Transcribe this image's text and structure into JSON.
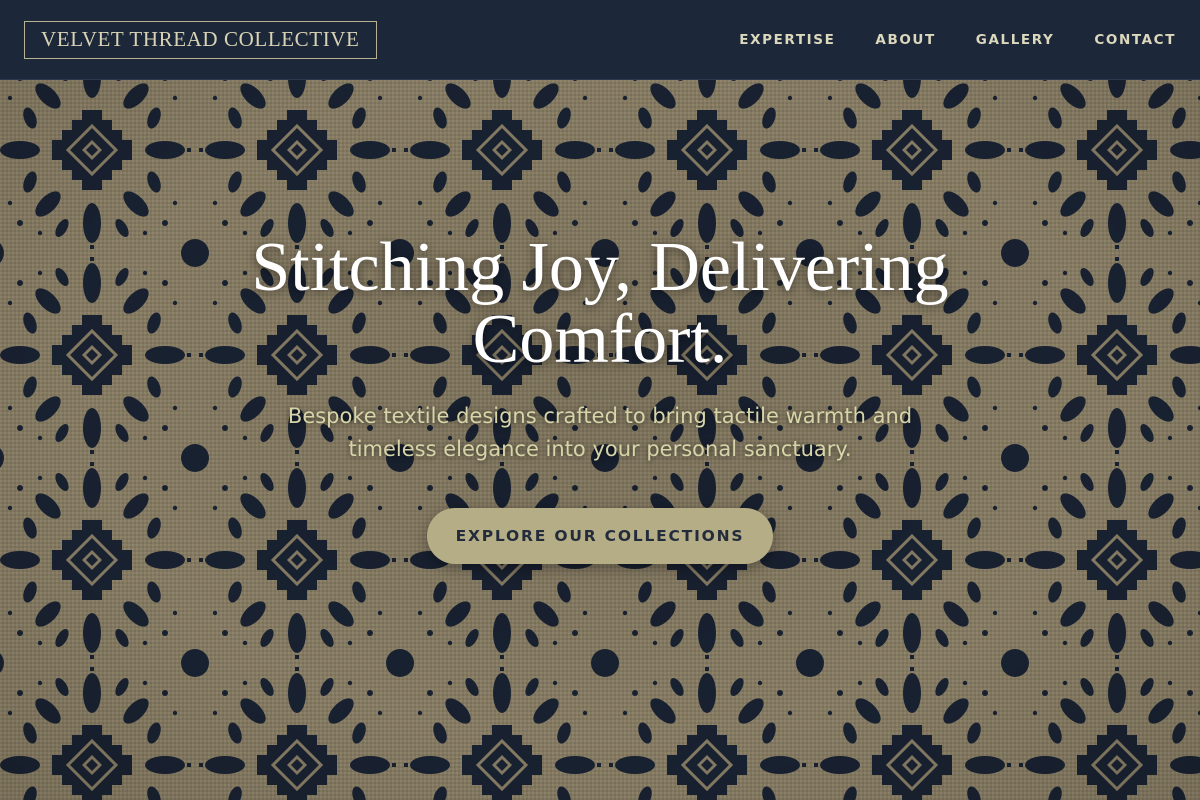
{
  "header": {
    "logo": "VELVET THREAD COLLECTIVE",
    "nav": [
      {
        "label": "EXPERTISE"
      },
      {
        "label": "ABOUT"
      },
      {
        "label": "GALLERY"
      },
      {
        "label": "CONTACT"
      }
    ]
  },
  "hero": {
    "title": "Stitching Joy, Delivering Comfort.",
    "subtitle": "Bespoke textile designs crafted to bring tactile warmth and timeless elegance into your personal sanctuary.",
    "cta_label": "EXPLORE OUR COLLECTIONS",
    "background_icon": "woven-damask-pattern"
  },
  "colors": {
    "header_bg": "#1c2739",
    "logo_text": "#d8d3b4",
    "nav_text": "#dcd8bd",
    "pattern_base": "#8c8168",
    "pattern_ink": "#1a2333",
    "subtitle_text": "#d6d4a8",
    "cta_bg": "#b4ad86",
    "cta_text": "#232c3b"
  }
}
